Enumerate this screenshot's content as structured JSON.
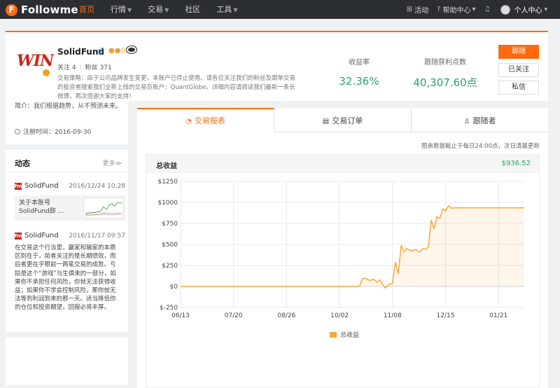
{
  "brand": {
    "logo_letter": "F",
    "name": "Followme",
    "accent": "#ff6a10"
  },
  "nav": {
    "items": [
      {
        "label": "首页",
        "active": true,
        "dropdown": false
      },
      {
        "label": "行情",
        "active": false,
        "dropdown": true
      },
      {
        "label": "交易",
        "active": false,
        "dropdown": true
      },
      {
        "label": "社区",
        "active": false,
        "dropdown": false
      },
      {
        "label": "工具",
        "active": false,
        "dropdown": true
      }
    ],
    "right": {
      "activity": "活动",
      "help": "帮助中心",
      "user_center": "个人中心"
    }
  },
  "profile": {
    "logo_text": "WIN",
    "name": "SolidFund",
    "gender_icon": "male-icon",
    "followers_badge": "02",
    "follow_label": "关注",
    "follow_count": "4",
    "fans_label": "粉丝",
    "fans_count": "371",
    "strategy": "交易策略：由于公司品牌发生变更，本账户已停止使用。请各位关注我们的粉丝及跟单交易的投资者搜索我们全新上线的交易员账户：QuantGlobe。详细内容请阅读我们最新一条长微博，再次感谢大家的支持！",
    "metrics": [
      {
        "label": "收益率",
        "value": "32.36%"
      },
      {
        "label": "跟随获利点数",
        "value": "40,307.60点"
      }
    ],
    "buttons": {
      "follow": "跟随",
      "followed": "已关注",
      "message": "私信"
    }
  },
  "sidebar": {
    "intro": "简介：我们根据趋势，从不预测未来。",
    "registered": "注册时间：2016-09-30",
    "dynamics_title": "动态",
    "more": "更多≫",
    "posts": [
      {
        "author": "SolidFund",
        "time": "2016/12/24 10:28",
        "preview": "关于本账号SolidFund即 ..."
      },
      {
        "author": "SolidFund",
        "time": "2016/11/17 09:57",
        "body": "在交易这个行当里，赢家和输家的本质区别在于，前者关注的是长期绩效，而后者更在乎眼前一两笔交易的成败。亏损是这个“游戏”与生俱来的一部分，如果你不承担任何风险，你就无法获得收益；如果你不学会控制风险，那你就无法等到利润到来的那一天。适当降低你的仓位和投资期望，回报必将丰厚。"
      }
    ]
  },
  "main": {
    "tabs": [
      {
        "label": "交易报表",
        "icon": "pie-chart-icon",
        "active": true
      },
      {
        "label": "交易订单",
        "icon": "document-icon",
        "active": false
      },
      {
        "label": "跟随者",
        "icon": "user-icon",
        "active": false
      }
    ],
    "note": "图表数据截止于每日24:00点，次日清晨更新",
    "chart_header": {
      "title": "总收益",
      "total": "$936.52"
    }
  },
  "chart_data": {
    "type": "area",
    "title": "总收益",
    "x_tick_labels": [
      "06/13",
      "07/20",
      "08/26",
      "10/02",
      "11/08",
      "12/15",
      "01/21"
    ],
    "y_tick_labels": [
      "$1250",
      "$1000",
      "$750",
      "$500",
      "$250",
      "$0",
      "$-250"
    ],
    "ylim": [
      -250,
      1250
    ],
    "xlim": [
      "2016-06-13",
      "2017-02-08"
    ],
    "grid": true,
    "legend_position": "bottom",
    "series": [
      {
        "name": "总收益",
        "color": "#f5a83c",
        "points": [
          [
            "2016-06-13",
            0
          ],
          [
            "2016-07-20",
            0
          ],
          [
            "2016-08-26",
            0
          ],
          [
            "2016-10-12",
            0
          ],
          [
            "2016-10-16",
            5
          ],
          [
            "2016-10-18",
            90
          ],
          [
            "2016-10-20",
            100
          ],
          [
            "2016-10-23",
            70
          ],
          [
            "2016-10-26",
            85
          ],
          [
            "2016-10-28",
            50
          ],
          [
            "2016-10-30",
            80
          ],
          [
            "2016-11-01",
            30
          ],
          [
            "2016-11-03",
            -20
          ],
          [
            "2016-11-05",
            20
          ],
          [
            "2016-11-08",
            40
          ],
          [
            "2016-11-10",
            290
          ],
          [
            "2016-11-12",
            150
          ],
          [
            "2016-11-14",
            490
          ],
          [
            "2016-11-16",
            410
          ],
          [
            "2016-11-18",
            450
          ],
          [
            "2016-11-21",
            420
          ],
          [
            "2016-11-24",
            440
          ],
          [
            "2016-11-27",
            410
          ],
          [
            "2016-11-29",
            450
          ],
          [
            "2016-12-01",
            440
          ],
          [
            "2016-12-03",
            470
          ],
          [
            "2016-12-05",
            790
          ],
          [
            "2016-12-07",
            690
          ],
          [
            "2016-12-09",
            830
          ],
          [
            "2016-12-11",
            810
          ],
          [
            "2016-12-13",
            920
          ],
          [
            "2016-12-15",
            900
          ],
          [
            "2016-12-17",
            960
          ],
          [
            "2016-12-19",
            930
          ],
          [
            "2016-12-22",
            936
          ],
          [
            "2017-01-21",
            936
          ],
          [
            "2017-02-08",
            936
          ]
        ]
      }
    ]
  }
}
